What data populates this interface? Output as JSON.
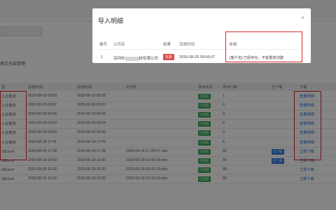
{
  "modal": {
    "title": "导入明细",
    "close": "×",
    "headers": [
      "编号",
      "公司名",
      "结果",
      "完成时间",
      "详细"
    ],
    "row": {
      "no": "1",
      "company_prefix": "深圳市",
      "company_suffix": "技有限公司",
      "result": "失败",
      "time": "2020-08-20 09:56:07",
      "detail": "[客户名] 已经存在，不能重复创建"
    }
  },
  "background": {
    "section_title": "表示全部清理",
    "headers": [
      "型",
      "创建时间",
      "完成时间",
      "文件名",
      "导出状态",
      "导出行数",
      "已下载",
      "下载"
    ],
    "rows": [
      {
        "type": "入企客资",
        "created": "2020-08-20 09:58",
        "done": "2020-08-20 09:58",
        "file": "",
        "status": "已完成",
        "count": "1",
        "downloaded": "",
        "action": "查看明细"
      },
      {
        "type": "入企客资",
        "created": "2020-08-20 09:57",
        "done": "2020-08-20 09:57",
        "file": "",
        "status": "已完成",
        "count": "0",
        "downloaded": "",
        "action": "查看明细"
      },
      {
        "type": "入企客资",
        "created": "2020-08-20 09:56",
        "done": "2020-08-20 09:56",
        "file": "",
        "status": "已完成",
        "count": "0",
        "downloaded": "",
        "action": "查看明细"
      },
      {
        "type": "入企客资",
        "created": "2020-08-20 09:54",
        "done": "2020-08-20 09:54",
        "file": "",
        "status": "已完成",
        "count": "0",
        "downloaded": "",
        "action": "查看明细"
      },
      {
        "type": "入企客资",
        "created": "2020-08-20 09:50",
        "done": "2020-08-20 09:50",
        "file": "",
        "status": "已完成",
        "count": "0",
        "downloaded": "",
        "action": "查看明细"
      },
      {
        "type": "入企客资",
        "created": "2020-08-19 17:41",
        "done": "2020-08-19 17:41",
        "file": "",
        "status": "已完成",
        "count": "4",
        "downloaded": "",
        "action": "查看明细"
      },
      {
        "type": "出Excel",
        "created": "2020-08-19 17:28",
        "done": "2020-08-19 17:28",
        "file": "2020-08-19-17-28-57.xlsx",
        "status": "已完成",
        "count": "56",
        "downloaded": "已下载",
        "action": "立即下载"
      },
      {
        "type": "出Excel",
        "created": "2020-08-19 16:50",
        "done": "2020-08-19 16:50",
        "file": "2020-08-19-16-50-29.xlsx",
        "status": "已完成",
        "count": "56",
        "downloaded": "已下载",
        "action": "立即下载"
      },
      {
        "type": "出Excel",
        "created": "2020-08-19 16:32",
        "done": "2020-08-19 16:32",
        "file": "2020-08-19-16-32-14.xlsx",
        "status": "已完成",
        "count": "68",
        "downloaded": "",
        "action": "立即下载"
      },
      {
        "type": "出Excel",
        "created": "2020-08-19 16:32",
        "done": "2020-08-19 16:32",
        "file": "2020-08-19-16-32-02.xlsx",
        "status": "已完成",
        "count": "68",
        "downloaded": "",
        "action": "立即下载"
      }
    ]
  },
  "colors": {
    "highlight": "#e0252b",
    "link": "#2a6fd6",
    "success": "#3aa657",
    "failed": "#e04a4a"
  }
}
